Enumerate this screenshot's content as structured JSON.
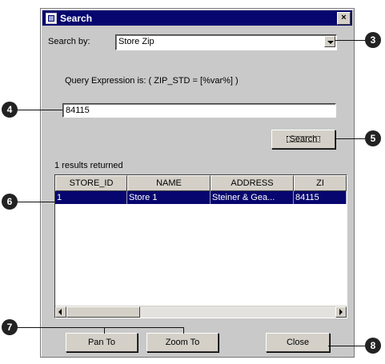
{
  "window": {
    "title": "Search",
    "close_glyph": "×"
  },
  "search": {
    "by_label": "Search by:",
    "by_value": "Store Zip",
    "expression": "Query Expression is: ( ZIP_STD = [%var%] )",
    "value": "84115",
    "button": "Search"
  },
  "results": {
    "count_label": "1 results returned",
    "columns": [
      "STORE_ID",
      "NAME",
      "ADDRESS",
      "ZI"
    ],
    "rows": [
      [
        "1",
        "Store 1",
        "Steiner & Gea...",
        "84115"
      ]
    ],
    "selected_row": 0
  },
  "buttons": {
    "pan": "Pan To",
    "zoom": "Zoom To",
    "close": "Close"
  },
  "callouts": [
    "3",
    "4",
    "5",
    "6",
    "7",
    "8"
  ],
  "colors": {
    "titlebar": "#07066f",
    "dialog": "#c9c9c9",
    "selection": "#07066f"
  }
}
